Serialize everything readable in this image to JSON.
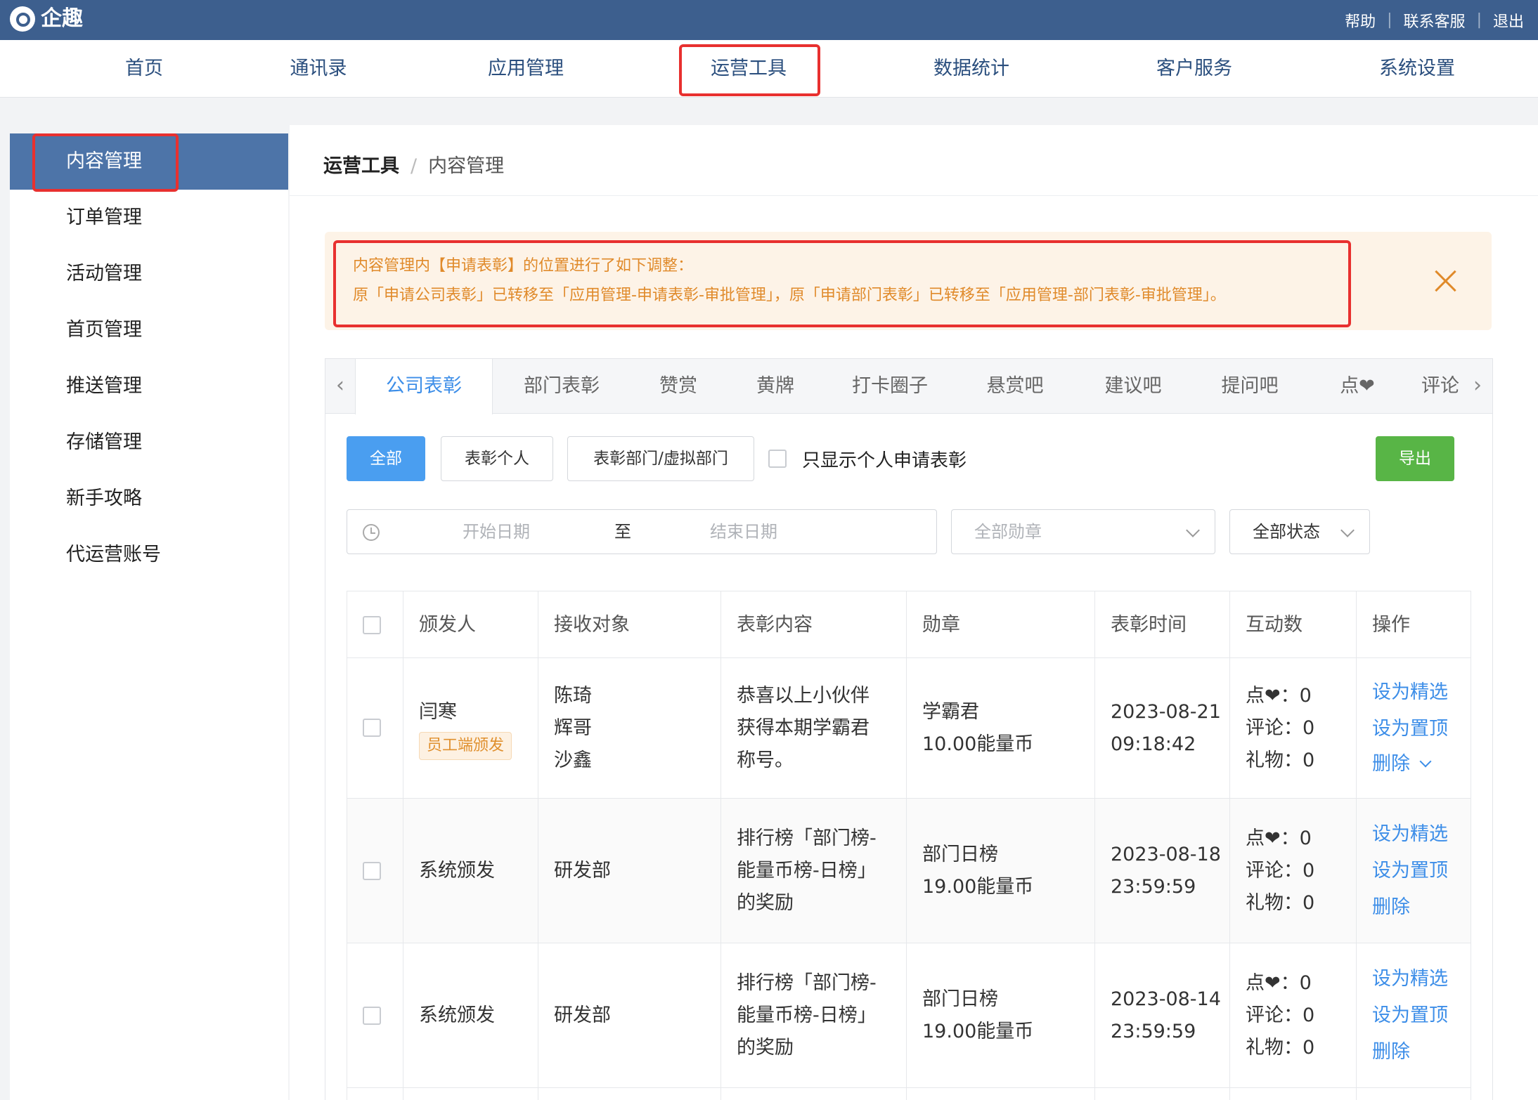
{
  "topbar": {
    "brand": "企趣",
    "links": [
      "帮助",
      "联系客服",
      "退出"
    ]
  },
  "nav": {
    "items": [
      "首页",
      "通讯录",
      "应用管理",
      "运营工具",
      "数据统计",
      "客户服务",
      "系统设置"
    ],
    "active": "运营工具"
  },
  "sidebar": {
    "items": [
      "内容管理",
      "订单管理",
      "活动管理",
      "首页管理",
      "推送管理",
      "存储管理",
      "新手攻略",
      "代运营账号"
    ],
    "active": "内容管理"
  },
  "breadcrumb": {
    "root": "运营工具",
    "separator": "/",
    "current": "内容管理"
  },
  "alert": {
    "line1": "内容管理内【申请表彰】的位置进行了如下调整：",
    "line2": "原「申请公司表彰」已转移至「应用管理-申请表彰-审批管理」，原「申请部门表彰」已转移至「应用管理-部门表彰-审批管理」。",
    "color": "#e08a2a"
  },
  "tabs": {
    "items": [
      "公司表彰",
      "部门表彰",
      "赞赏",
      "黄牌",
      "打卡圈子",
      "悬赏吧",
      "建议吧",
      "提问吧",
      "点❤",
      "评论"
    ],
    "active": "公司表彰",
    "prev_arrow": "‹",
    "next_arrow": "›"
  },
  "filters": {
    "all": "全部",
    "personal": "表彰个人",
    "dept": "表彰部门/虚拟部门",
    "only_personal": "只显示个人申请表彰",
    "export": "导出",
    "start_date_placeholder": "开始日期",
    "range_sep": "至",
    "end_date_placeholder": "结束日期",
    "medal_placeholder": "全部勋章",
    "status_value": "全部状态"
  },
  "table": {
    "headers": [
      "颁发人",
      "接收对象",
      "表彰内容",
      "勋章",
      "表彰时间",
      "互动数",
      "操作"
    ],
    "rows": [
      {
        "issuer": "闫寒",
        "issuer_tag": "员工端颁发",
        "receivers": [
          "陈琦",
          "辉哥",
          "沙鑫"
        ],
        "content": [
          "恭喜以上小伙伴",
          "获得本期学霸君",
          "称号。"
        ],
        "medal": [
          "学霸君",
          "10.00能量币"
        ],
        "time": [
          "2023-08-21",
          "09:18:42"
        ],
        "likes": "点❤：0",
        "comments": "评论：0",
        "gifts": "礼物：0",
        "actions": [
          "设为精选",
          "设为置顶",
          "删除"
        ]
      },
      {
        "issuer": "系统颁发",
        "receivers": [
          "研发部"
        ],
        "content": [
          "排行榜「部门榜-",
          "能量币榜-日榜」",
          "的奖励"
        ],
        "medal": [
          "部门日榜",
          "19.00能量币"
        ],
        "time": [
          "2023-08-18",
          "23:59:59"
        ],
        "likes": "点❤：0",
        "comments": "评论：0",
        "gifts": "礼物：0",
        "actions": [
          "设为精选",
          "设为置顶",
          "删除"
        ]
      },
      {
        "issuer": "系统颁发",
        "receivers": [
          "研发部"
        ],
        "content": [
          "排行榜「部门榜-",
          "能量币榜-日榜」",
          "的奖励"
        ],
        "medal": [
          "部门日榜",
          "19.00能量币"
        ],
        "time": [
          "2023-08-14",
          "23:59:59"
        ],
        "likes": "点❤：0",
        "comments": "评论：0",
        "gifts": "礼物：0",
        "actions": [
          "设为精选",
          "设为置顶",
          "删除"
        ]
      }
    ]
  },
  "colors": {
    "topbar": "#3d5f8e",
    "sidebar_active": "#4d74a8",
    "primary": "#4a9ef0",
    "export": "#58b546",
    "link": "#3d8ee8",
    "highlight": "#e8302f"
  }
}
